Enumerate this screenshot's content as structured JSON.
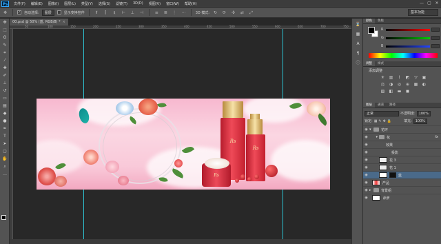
{
  "app": {
    "logo": "Ps"
  },
  "menu": [
    "文件(F)",
    "编辑(E)",
    "图像(I)",
    "图层(L)",
    "类型(Y)",
    "选择(S)",
    "滤镜(T)",
    "3D(D)",
    "视图(V)",
    "窗口(W)",
    "帮助(H)"
  ],
  "window_controls": [
    "—",
    "▢",
    "✕"
  ],
  "options": {
    "tool_icon": "move-tool-icon",
    "auto_select_label": "自动选择:",
    "auto_select_value": "图层",
    "show_transform_label": "显示变换控件",
    "mode_label": "3D 模式:",
    "workspace": "基本功能"
  },
  "document": {
    "tab_title": "00.psd @ 50% (蓝, RGB/8) *",
    "close": "×"
  },
  "ruler_ticks": [
    "50",
    "100",
    "150",
    "200",
    "250",
    "300",
    "350",
    "400",
    "450",
    "500",
    "550",
    "600",
    "650",
    "700",
    "750"
  ],
  "toolbar_icons": [
    "move-icon",
    "marquee-icon",
    "lasso-icon",
    "quick-select-icon",
    "crop-icon",
    "eyedropper-icon",
    "healing-icon",
    "brush-icon",
    "stamp-icon",
    "history-brush-icon",
    "eraser-icon",
    "gradient-icon",
    "blur-icon",
    "dodge-icon",
    "pen-icon",
    "type-icon",
    "path-select-icon",
    "shape-icon",
    "hand-icon",
    "zoom-icon"
  ],
  "banner": {
    "bottle_tall_label": "Rs",
    "bottle_short_label": "Rs",
    "jar_label": "Rs"
  },
  "color_panel": {
    "tabs": [
      "颜色",
      "色板"
    ],
    "channels": [
      "R",
      "G",
      "B"
    ],
    "colors": {
      "r": "#d04040",
      "g": "#3aa03a",
      "b": "#3050c0"
    }
  },
  "adjust_panel": {
    "tabs": [
      "调整",
      "样式"
    ],
    "title": "添加调整"
  },
  "layers_panel": {
    "tabs": [
      "图层",
      "通道",
      "路径"
    ],
    "blend_mode": "正常",
    "opacity_label": "不透明度:",
    "opacity_value": "100%",
    "lock_label": "锁定:",
    "fill_label": "填充:",
    "fill_value": "100%",
    "layers": [
      {
        "name": "花环",
        "type": "folder",
        "indent": 0
      },
      {
        "name": "花",
        "type": "folder",
        "indent": 1,
        "fx": "fx"
      },
      {
        "name": "效果",
        "type": "sub",
        "indent": 2
      },
      {
        "name": "投影",
        "type": "sub",
        "indent": 3
      },
      {
        "name": "花 3",
        "type": "layer",
        "indent": 1
      },
      {
        "name": "花 1",
        "type": "layer",
        "indent": 1
      },
      {
        "name": "蓝",
        "type": "layer",
        "indent": 1,
        "active": true
      },
      {
        "name": "产品",
        "type": "layer",
        "indent": 0
      },
      {
        "name": "背景组",
        "type": "folder",
        "indent": 0
      },
      {
        "name": "背景",
        "type": "layer",
        "indent": 0
      }
    ]
  }
}
